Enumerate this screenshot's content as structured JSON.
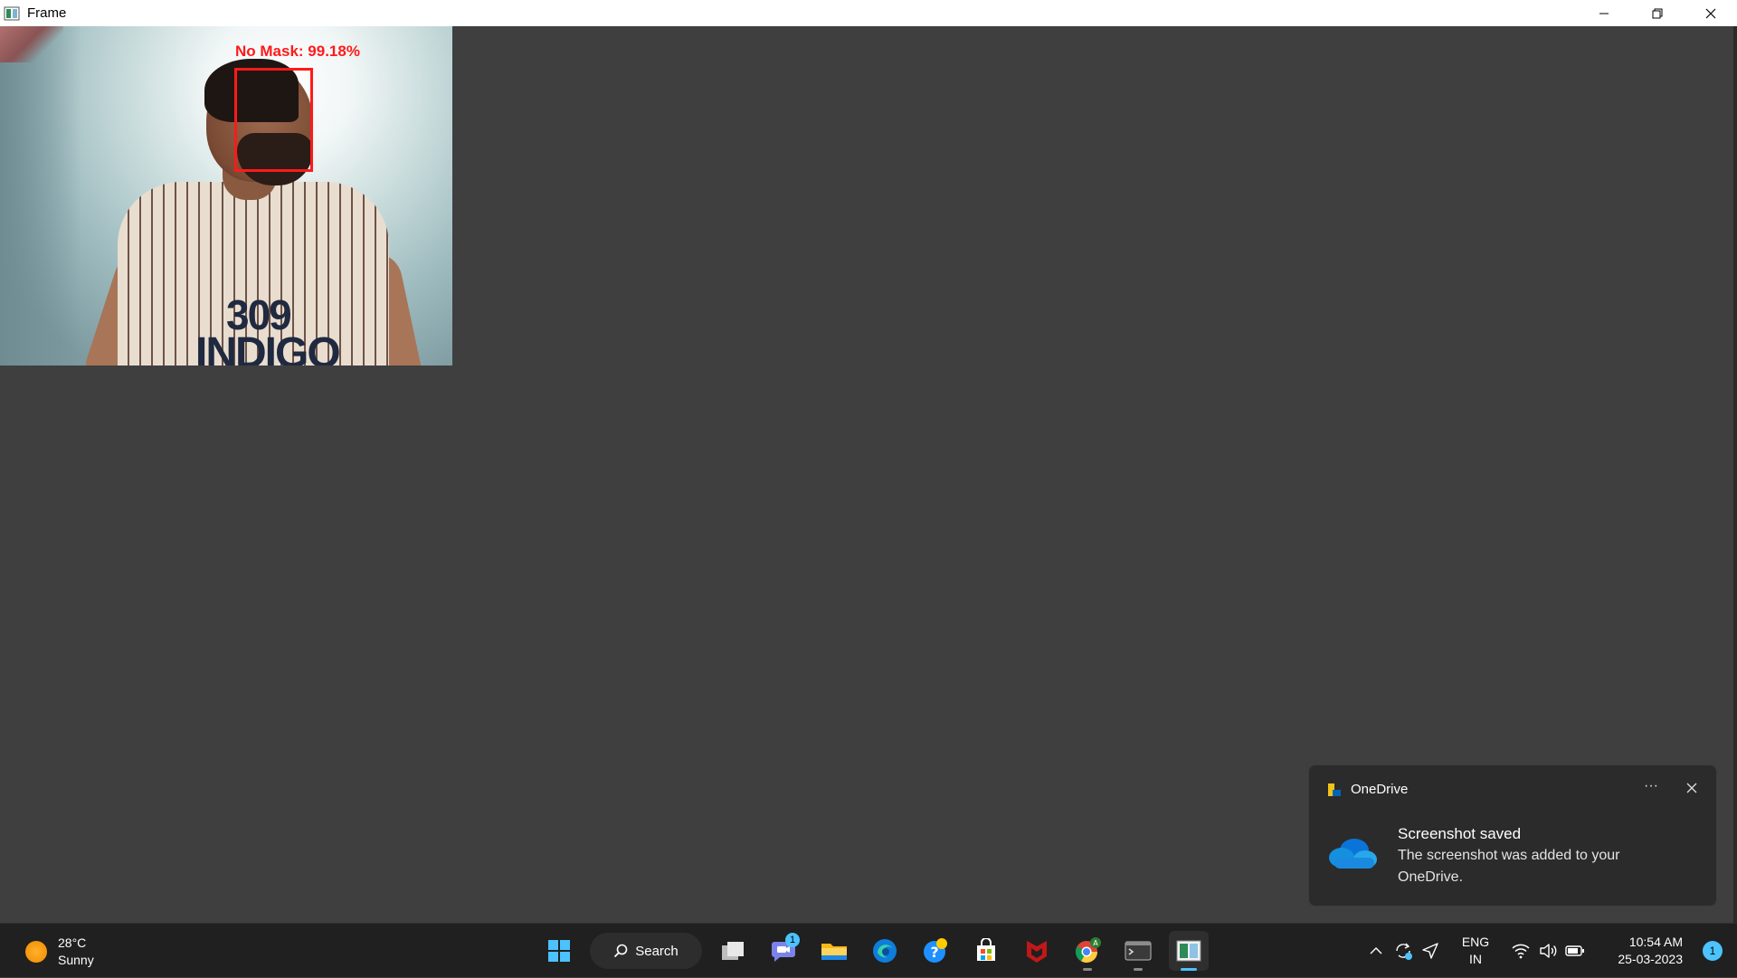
{
  "window": {
    "title": "Frame",
    "controls": {
      "minimize": "minimize-icon",
      "restore": "restore-icon",
      "close": "close-icon"
    }
  },
  "video": {
    "detection_label": "No Mask: 99.18%",
    "shirt_text_line1": "309",
    "shirt_text_line2": "INDIGO",
    "box_color": "#ff1a1a"
  },
  "toast": {
    "app_name": "OneDrive",
    "title": "Screenshot saved",
    "body": "The screenshot was added to your OneDrive.",
    "more_label": "···"
  },
  "taskbar": {
    "weather": {
      "temp": "28°C",
      "condition": "Sunny"
    },
    "search_label": "Search",
    "apps": [
      {
        "name": "start-icon"
      },
      {
        "name": "task-view-icon"
      },
      {
        "name": "teams-chat-icon",
        "badge": "1"
      },
      {
        "name": "file-explorer-icon"
      },
      {
        "name": "edge-icon"
      },
      {
        "name": "get-help-icon"
      },
      {
        "name": "microsoft-store-icon"
      },
      {
        "name": "mcafee-icon"
      },
      {
        "name": "chrome-icon"
      },
      {
        "name": "terminal-icon"
      },
      {
        "name": "frame-app-icon"
      }
    ],
    "tray": {
      "lang_line1": "ENG",
      "lang_line2": "IN",
      "time": "10:54 AM",
      "date": "25-03-2023",
      "notification_count": "1"
    }
  },
  "colors": {
    "accent": "#4cc2ff",
    "desktop": "#3f3f3f",
    "taskbar": "#202020"
  }
}
